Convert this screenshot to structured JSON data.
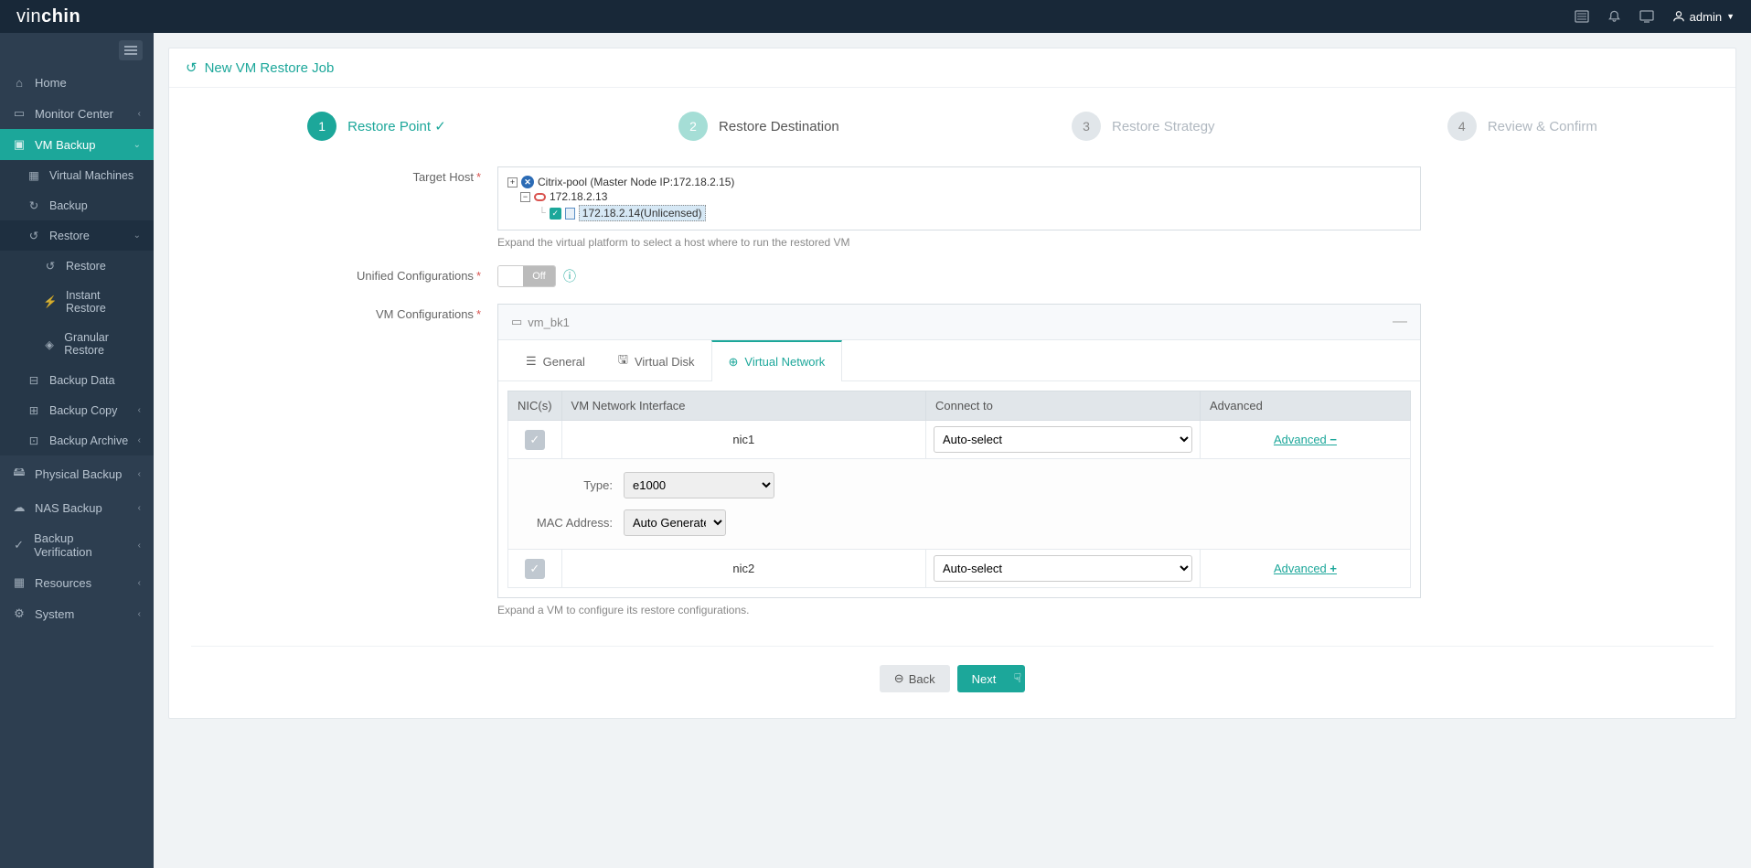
{
  "brand": {
    "part1": "vin",
    "part2": "chin"
  },
  "user": "admin",
  "page_title": "New VM Restore Job",
  "sidebar": {
    "items": [
      {
        "label": "Home"
      },
      {
        "label": "Monitor Center"
      },
      {
        "label": "VM Backup"
      },
      {
        "label": "Physical Backup"
      },
      {
        "label": "NAS Backup"
      },
      {
        "label": "Backup Verification"
      },
      {
        "label": "Resources"
      },
      {
        "label": "System"
      }
    ],
    "vm_backup_sub": [
      {
        "label": "Virtual Machines"
      },
      {
        "label": "Backup"
      },
      {
        "label": "Restore"
      },
      {
        "label": "Backup Data"
      },
      {
        "label": "Backup Copy"
      },
      {
        "label": "Backup Archive"
      }
    ],
    "restore_sub": [
      {
        "label": "Restore"
      },
      {
        "label": "Instant Restore"
      },
      {
        "label": "Granular Restore"
      }
    ]
  },
  "steps": [
    {
      "num": "1",
      "label": "Restore Point"
    },
    {
      "num": "2",
      "label": "Restore Destination"
    },
    {
      "num": "3",
      "label": "Restore Strategy"
    },
    {
      "num": "4",
      "label": "Review & Confirm"
    }
  ],
  "form": {
    "target_host_label": "Target Host",
    "tree": {
      "pool": "Citrix-pool (Master Node IP:172.18.2.15)",
      "host1": "172.18.2.13",
      "host2": "172.18.2.14(Unlicensed)"
    },
    "target_help": "Expand the virtual platform to select a host where to run the restored VM",
    "unified_label": "Unified Configurations",
    "toggle_off": "Off",
    "vm_config_label": "VM Configurations",
    "vm_name": "vm_bk1",
    "tabs": {
      "general": "General",
      "disk": "Virtual Disk",
      "network": "Virtual Network"
    },
    "nic_table": {
      "col_nic": "NIC(s)",
      "col_iface": "VM Network Interface",
      "col_connect": "Connect to",
      "col_adv": "Advanced",
      "nic1": "nic1",
      "nic2": "nic2",
      "connect_val": "Auto-select",
      "adv_link": "Advanced"
    },
    "adv": {
      "type_label": "Type:",
      "type_val": "e1000",
      "mac_label": "MAC Address:",
      "mac_val": "Auto Generate"
    },
    "vm_help": "Expand a VM to configure its restore configurations."
  },
  "buttons": {
    "back": "Back",
    "next": "Next"
  }
}
